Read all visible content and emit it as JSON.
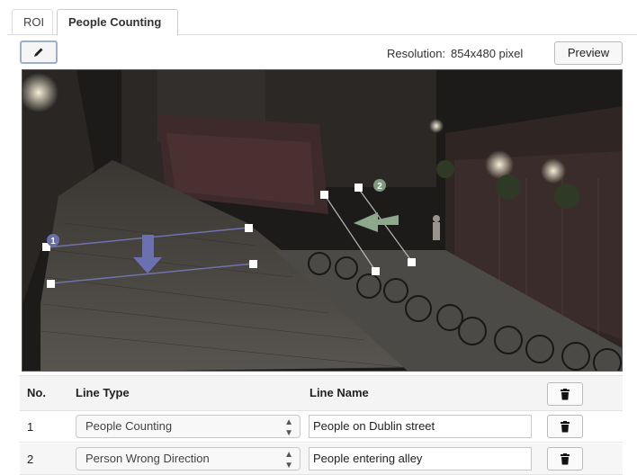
{
  "tabs": [
    {
      "label": "ROI",
      "active": false
    },
    {
      "label": "People Counting",
      "active": true
    }
  ],
  "toolbar": {
    "edit_icon": "pencil-icon",
    "resolution_label": "Resolution:",
    "resolution_value": "854x480 pixel",
    "preview_label": "Preview"
  },
  "view": {
    "line_markers": [
      {
        "number": "1",
        "color": "#6b6fa8"
      },
      {
        "number": "2",
        "color": "#7f9a7f"
      }
    ],
    "direction_arrow_colors": [
      "#6a70b0",
      "#8da88d"
    ]
  },
  "table": {
    "headers": {
      "no": "No.",
      "line_type": "Line Type",
      "line_name": "Line Name"
    },
    "delete_icon": "trash-icon",
    "rows": [
      {
        "no": "1",
        "line_type": "People Counting",
        "line_name": "People on Dublin street"
      },
      {
        "no": "2",
        "line_type": "Person Wrong Direction",
        "line_name": "People entering alley"
      }
    ]
  }
}
